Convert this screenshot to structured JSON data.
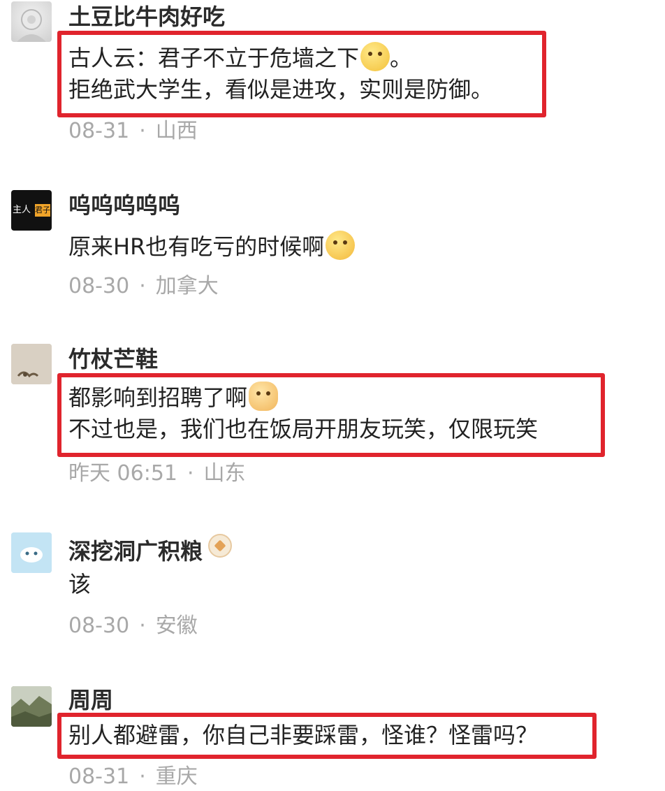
{
  "comments": [
    {
      "username": "土豆比牛肉好吃",
      "lines": [
        "古人云：君子不立于危墙之下",
        "拒绝武大学生，看似是进攻，实则是防御。"
      ],
      "line1_suffix": "。",
      "emoji": "thinking-face-icon",
      "date": "08-31",
      "location": "山西",
      "highlighted": true
    },
    {
      "username": "呜呜呜呜呜",
      "avatar_text": [
        "主人",
        "君子"
      ],
      "lines": [
        "原来HR也有吃亏的时候啊"
      ],
      "emoji": "grinning-face-icon",
      "date": "08-30",
      "location": "加拿大",
      "highlighted": false
    },
    {
      "username": "竹杖芒鞋",
      "lines": [
        "都影响到招聘了啊",
        "不过也是，我们也在饭局开朋友玩笑，仅限玩笑"
      ],
      "emoji": "dog-face-icon",
      "date": "昨天 06:51",
      "location": "山东",
      "highlighted": true
    },
    {
      "username": "深挖洞广积粮",
      "badge": "badge-icon",
      "lines": [
        "该"
      ],
      "date": "08-30",
      "location": "安徽",
      "highlighted": false
    },
    {
      "username": "周周",
      "lines": [
        "别人都避雷，你自己非要踩雷，怪谁？怪雷吗？"
      ],
      "date": "08-31",
      "location": "重庆",
      "highlighted": true
    }
  ],
  "meta_separator": "·",
  "colors": {
    "highlight_border": "#e0242d",
    "meta_text": "#a8a8a8",
    "username_text": "#2b2b2b",
    "body_text": "#222222"
  }
}
